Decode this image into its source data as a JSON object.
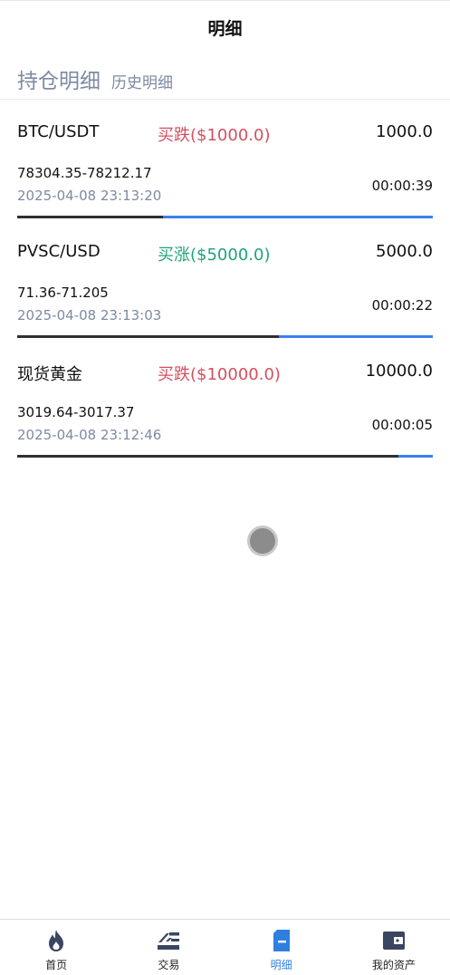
{
  "header": {
    "title": "明细"
  },
  "tabs": {
    "active": "持仓明细",
    "inactive": "历史明细"
  },
  "positions": [
    {
      "pair": "BTC/USDT",
      "action": "买跌($1000.0)",
      "direction": "down",
      "amount": "1000.0",
      "prices": "78304.35-78212.17",
      "time": "2025-04-08 23:13:20",
      "countdown": "00:00:39",
      "progress": 0.35
    },
    {
      "pair": "PVSC/USD",
      "action": "买涨($5000.0)",
      "direction": "up",
      "amount": "5000.0",
      "prices": "71.36-71.205",
      "time": "2025-04-08 23:13:03",
      "countdown": "00:00:22",
      "progress": 0.63
    },
    {
      "pair": "现货黄金",
      "action": "买跌($10000.0)",
      "direction": "down",
      "amount": "10000.0",
      "prices": "3019.64-3017.37",
      "time": "2025-04-08 23:12:46",
      "countdown": "00:00:05",
      "progress": 0.917
    }
  ],
  "colors": {
    "down": "#d4505f",
    "up": "#1fa37a",
    "accent": "#2f7fe0",
    "icon": "#3a4660"
  },
  "tabbar": {
    "items": [
      {
        "label": "首页",
        "icon": "flame-icon"
      },
      {
        "label": "交易",
        "icon": "trade-icon"
      },
      {
        "label": "明细",
        "icon": "document-icon"
      },
      {
        "label": "我的资产",
        "icon": "wallet-icon"
      }
    ],
    "active_index": 2
  }
}
